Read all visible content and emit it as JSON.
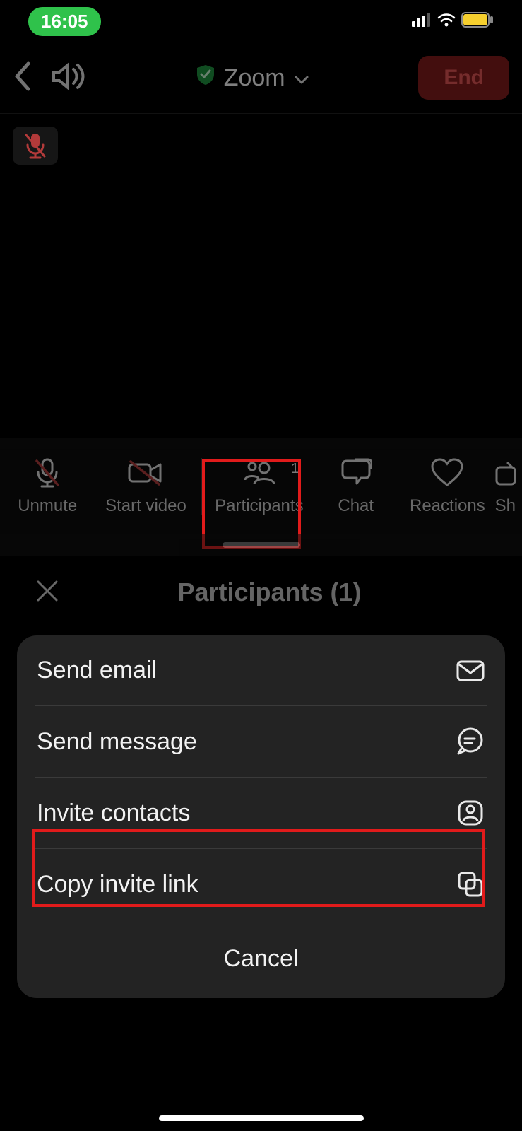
{
  "status": {
    "time": "16:05"
  },
  "header": {
    "title": "Zoom",
    "end_label": "End"
  },
  "toolbar": {
    "unmute": "Unmute",
    "start_video": "Start video",
    "participants": "Participants",
    "participants_count": "1",
    "chat": "Chat",
    "reactions": "Reactions",
    "share": "Sh"
  },
  "panel": {
    "title": "Participants (1)"
  },
  "sheet": {
    "send_email": "Send email",
    "send_message": "Send message",
    "invite_contacts": "Invite contacts",
    "copy_link": "Copy invite link",
    "cancel": "Cancel"
  }
}
